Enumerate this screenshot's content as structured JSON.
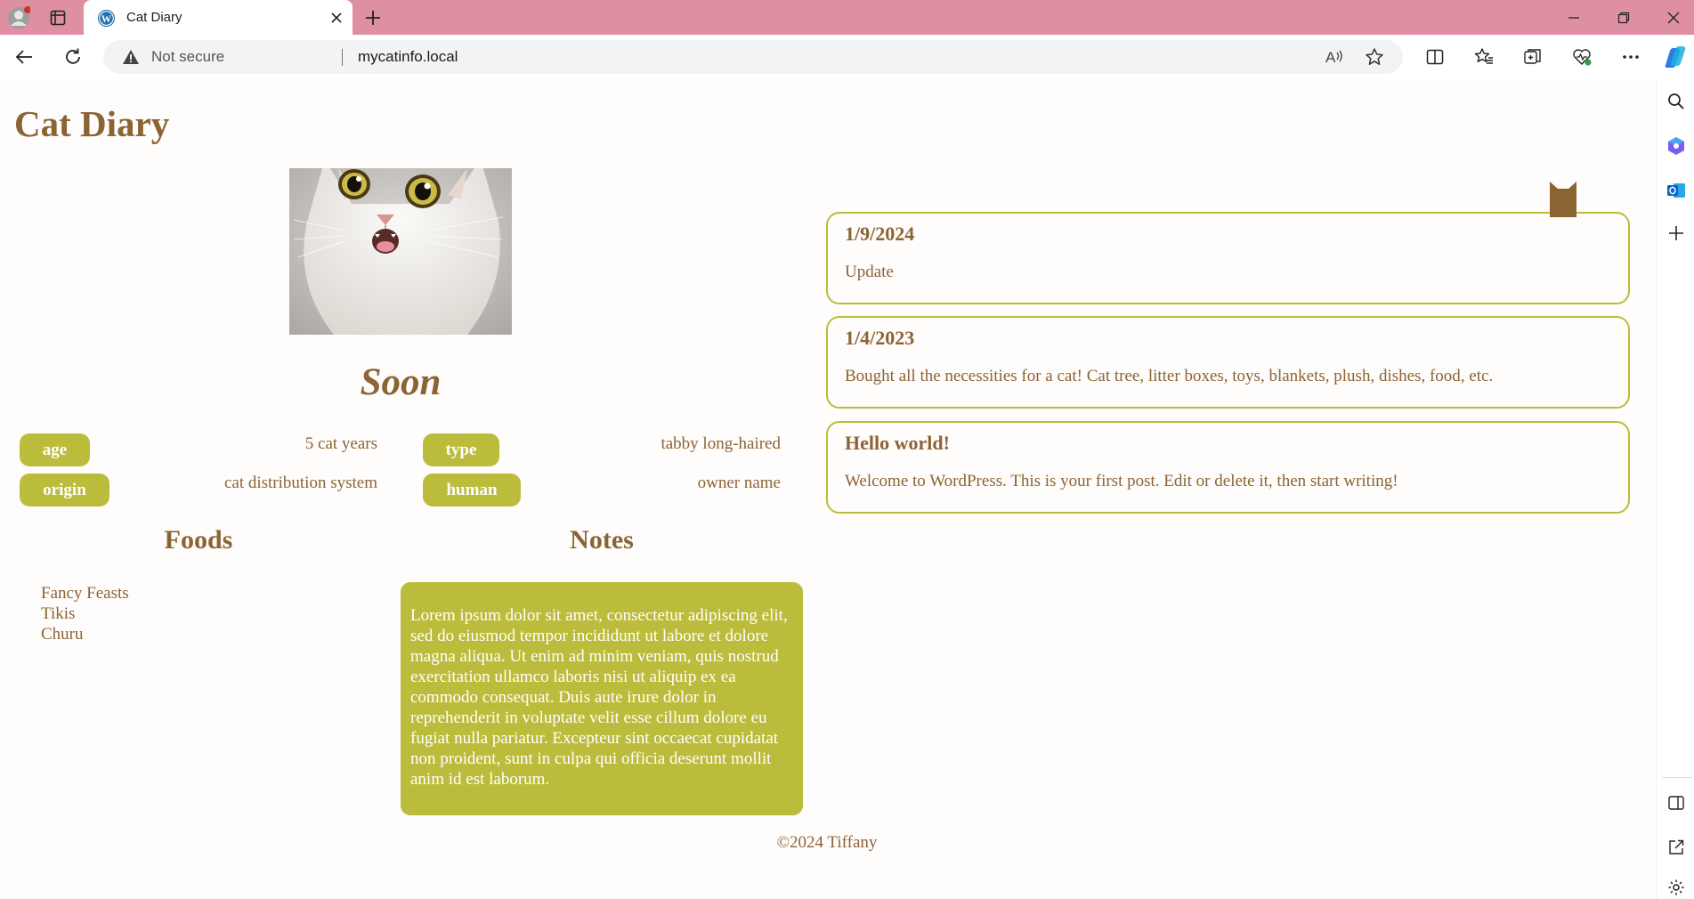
{
  "browser": {
    "tab_title": "Cat Diary",
    "security_label": "Not secure",
    "url": "mycatinfo.local"
  },
  "page": {
    "site_title": "Cat Diary",
    "cat_name": "Soon",
    "stats": [
      {
        "label": "age",
        "value": "5 cat years"
      },
      {
        "label": "type",
        "value": "tabby long-haired"
      },
      {
        "label": "origin",
        "value": "cat distribution system"
      },
      {
        "label": "human",
        "value": "owner name"
      }
    ],
    "foods_heading": "Foods",
    "foods": [
      "Fancy Feasts",
      "Tikis",
      "Churu"
    ],
    "notes_heading": "Notes",
    "notes_text": "Lorem ipsum dolor sit amet, consectetur adipiscing elit, sed do eiusmod tempor incididunt ut labore et dolore magna aliqua. Ut enim ad minim veniam, quis nostrud exercitation ullamco laboris nisi ut aliquip ex ea commodo consequat. Duis aute irure dolor in reprehenderit in voluptate velit esse cillum dolore eu fugiat nulla pariatur. Excepteur sint occaecat cupidatat non proident, sunt in culpa qui officia deserunt mollit anim id est laborum.",
    "footer": "©2024 Tiffany"
  },
  "posts": [
    {
      "title": "1/9/2024",
      "body": "Update"
    },
    {
      "title": "1/4/2023",
      "body": "Bought all the necessities for a cat! Cat tree, litter boxes, toys, blankets, plush, dishes, food, etc."
    },
    {
      "title": "Hello world!",
      "body": "Welcome to WordPress. This is your first post. Edit or delete it, then start writing!"
    }
  ],
  "colors": {
    "accent": "#bcbc3c",
    "text": "#8b6433",
    "titlebar": "#de8fa1",
    "background": "#fffcfc"
  },
  "icons": [
    "profile-icon",
    "tab-actions-icon",
    "wordpress-icon",
    "close-icon",
    "new-tab-icon",
    "minimize-icon",
    "restore-icon",
    "window-close-icon",
    "back-icon",
    "refresh-icon",
    "warning-icon",
    "read-aloud-icon",
    "favorite-star-icon",
    "split-screen-icon",
    "favorites-icon",
    "collections-icon",
    "browser-essentials-icon",
    "more-icon",
    "copilot-icon",
    "search-icon",
    "shopping-icon",
    "outlook-icon",
    "add-icon",
    "sidebar-toggle-icon",
    "external-link-icon",
    "settings-icon",
    "bookmark-icon"
  ]
}
